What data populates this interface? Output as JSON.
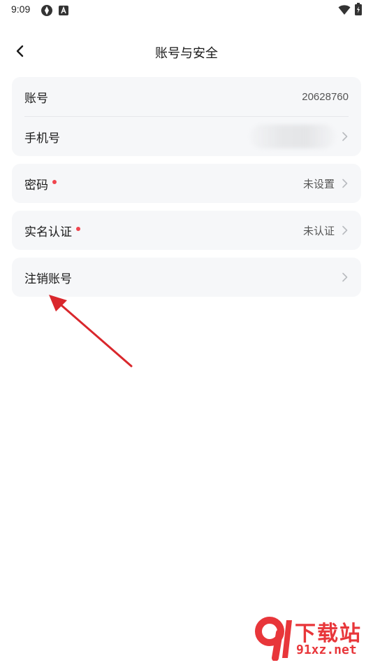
{
  "status_bar": {
    "time": "9:09"
  },
  "header": {
    "title": "账号与安全"
  },
  "account_card": {
    "account_label": "账号",
    "account_value": "20628760",
    "phone_label": "手机号"
  },
  "password_card": {
    "label": "密码",
    "value": "未设置"
  },
  "realname_card": {
    "label": "实名认证",
    "value": "未认证"
  },
  "cancel_card": {
    "label": "注销账号"
  },
  "watermark": {
    "line1": "下载站",
    "line2": "91xz.net"
  },
  "colors": {
    "red_dot": "#f0454e",
    "annotation_arrow": "#d9272c",
    "card_bg": "#f6f7f9"
  }
}
